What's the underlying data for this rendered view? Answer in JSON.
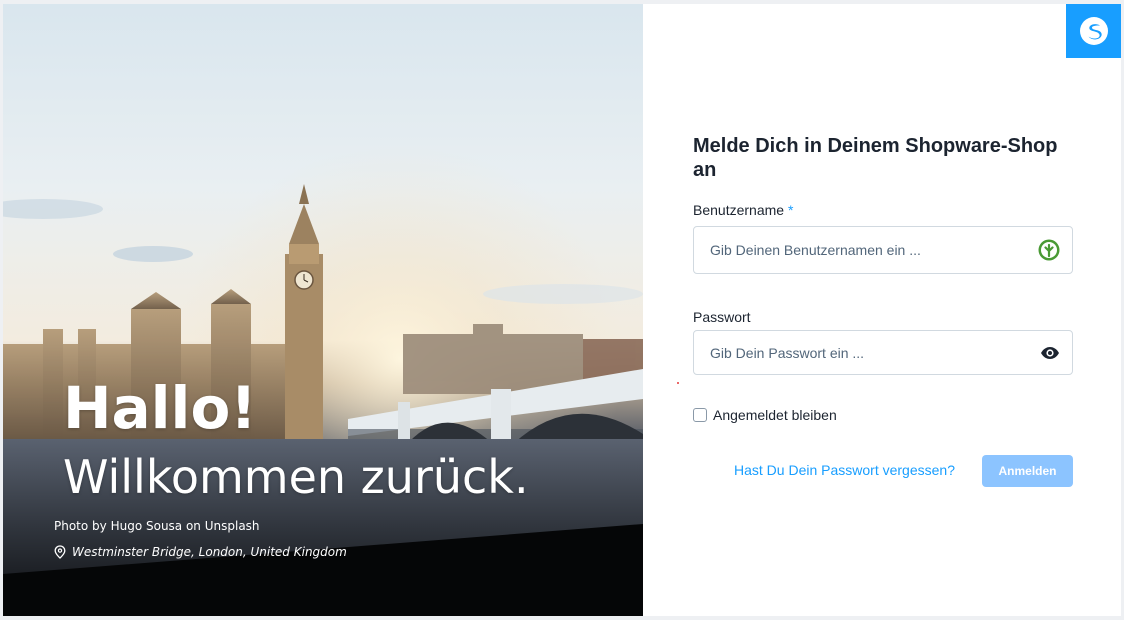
{
  "hero": {
    "headline": "Hallo!",
    "subline": "Willkommen zurück.",
    "photo_credit": "Photo by Hugo Sousa on Unsplash",
    "location": "Westminster Bridge, London, United Kingdom",
    "location_icon": "map-pin-icon"
  },
  "brand": {
    "logo_icon": "shopware-logo-icon",
    "color": "#189eff"
  },
  "login": {
    "title": "Melde Dich in Deinem Shopware-Shop an",
    "username": {
      "label": "Benutzername",
      "required_marker": "*",
      "placeholder": "Gib Deinen Benutzernamen ein ...",
      "value": "",
      "icon": "password-manager-icon"
    },
    "password": {
      "label": "Passwort",
      "placeholder": "Gib Dein Passwort ein ...",
      "value": "",
      "icon": "eye-icon"
    },
    "remember_me": {
      "label": "Angemeldet bleiben",
      "checked": false
    },
    "forgot_password_link": "Hast Du Dein Passwort vergessen?",
    "submit_label": "Anmelden"
  },
  "colors": {
    "accent": "#189eff",
    "button_disabled": "#8cc4ff",
    "text": "#1c2430",
    "border": "#d1d9e0"
  }
}
